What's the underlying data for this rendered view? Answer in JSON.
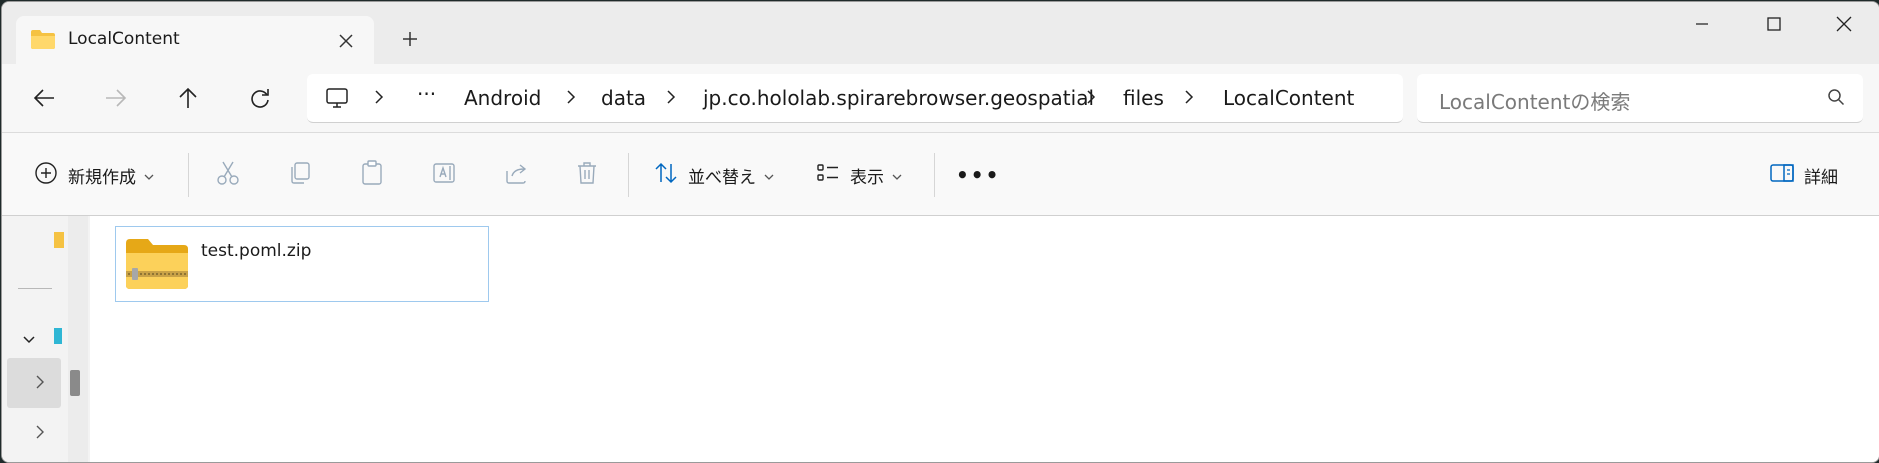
{
  "tab": {
    "title": "LocalContent",
    "close_icon": "close-icon",
    "new_tab_icon": "plus-icon"
  },
  "window_controls": [
    "minimize-icon",
    "maximize-icon",
    "close-icon"
  ],
  "nav": {
    "back_icon": "back-arrow-icon",
    "forward_icon": "forward-arrow-icon",
    "up_icon": "up-arrow-icon",
    "refresh_icon": "refresh-icon"
  },
  "address": {
    "root_icon": "monitor-icon",
    "overflow": "···",
    "crumbs": [
      "Android",
      "data",
      "jp.co.hololab.spirarebrowser.geospatial",
      "files",
      "LocalContent"
    ]
  },
  "search": {
    "placeholder": "LocalContentの検索",
    "icon": "search-icon"
  },
  "commands": {
    "new": "新規作成",
    "cut_icon": "scissors-icon",
    "copy_icon": "copy-icon",
    "paste_icon": "clipboard-icon",
    "rename_icon": "rename-icon",
    "share_icon": "share-icon",
    "delete_icon": "trash-icon",
    "sort": "並べ替え",
    "view": "表示",
    "more": "•••",
    "details": "詳細"
  },
  "files": [
    {
      "name": "test.poml.zip",
      "icon": "zip-folder-icon",
      "selected": true
    }
  ],
  "colors": {
    "accent": "#0067c0",
    "selection_border": "#9ec9ee",
    "folder": "#f5c242"
  }
}
